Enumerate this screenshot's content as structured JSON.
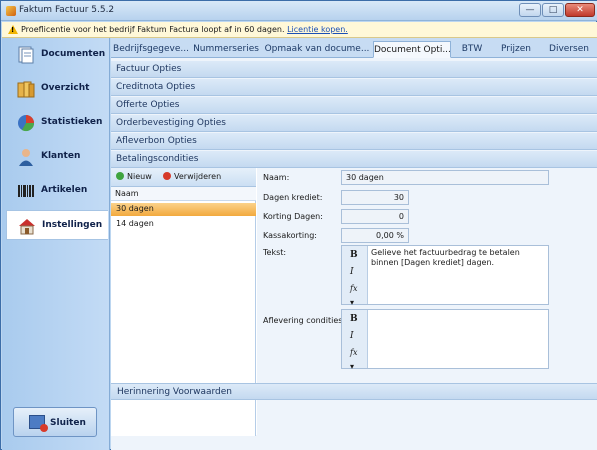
{
  "window": {
    "title": "Faktum Factuur 5.5.2",
    "btn_min": "—",
    "btn_max": "□",
    "btn_close": "✕"
  },
  "infobar": {
    "text": "Proeflicentie voor het bedrijf Faktum Factura loopt af in 60 dagen.",
    "link": "Licentie kopen."
  },
  "sidebar": {
    "items": [
      {
        "label": "Documenten"
      },
      {
        "label": "Overzicht"
      },
      {
        "label": "Statistieken"
      },
      {
        "label": "Klanten"
      },
      {
        "label": "Artikelen"
      },
      {
        "label": "Instellingen"
      }
    ],
    "close_label": "Sluiten"
  },
  "tabs": [
    "Bedrijfsgegeve...",
    "Nummerseries",
    "Opmaak van docume...",
    "Document Opti...",
    "BTW",
    "Prijzen",
    "Diversen"
  ],
  "sections": [
    "Factuur Opties",
    "Creditnota Opties",
    "Offerte Opties",
    "Orderbevestiging Opties",
    "Afleverbon Opties",
    "Betalingscondities"
  ],
  "list": {
    "btn_new": "Nieuw",
    "btn_delete": "Verwijderen",
    "header": "Naam",
    "rows": [
      "30 dagen",
      "14 dagen"
    ]
  },
  "form": {
    "naam_label": "Naam:",
    "naam_value": "30 dagen",
    "krediet_label": "Dagen krediet:",
    "krediet_value": "30",
    "korting_label": "Korting Dagen:",
    "korting_value": "0",
    "kassakorting_label": "Kassakorting:",
    "kassakorting_value": "0,00 %",
    "tekst_label": "Tekst:",
    "tekst_value": "Gelieve het factuurbedrag te betalen binnen [Dagen krediet] dagen.",
    "aflevering_label": "Aflevering condities:",
    "aflevering_value": "",
    "tool_bold": "B",
    "tool_italic": "I",
    "tool_fx": "fx ▾"
  },
  "bottom_section": "Herinnering Voorwaarden"
}
